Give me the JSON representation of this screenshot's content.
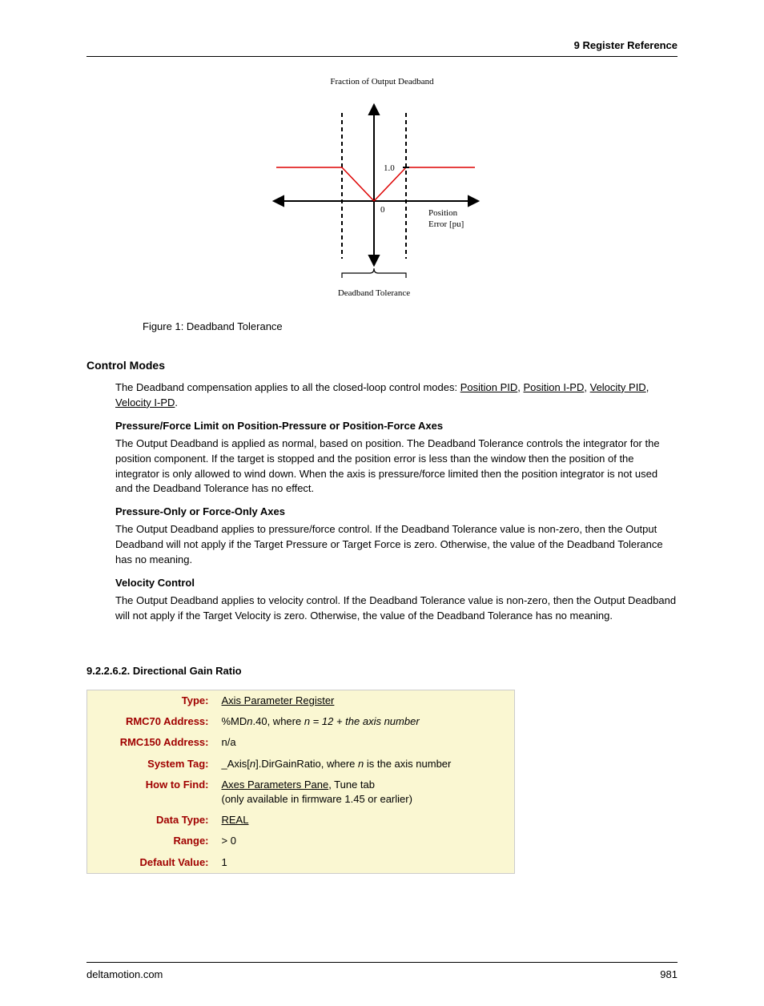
{
  "header": {
    "chapter": "9  Register Reference"
  },
  "figure": {
    "title_top": "Fraction of Output Deadband",
    "y_label": "1.0",
    "origin_label": "0",
    "x_axis_label_1": "Position",
    "x_axis_label_2": "Error [pu]",
    "bracket_label": "Deadband Tolerance",
    "caption": "Figure 1: Deadband Tolerance"
  },
  "control_modes": {
    "heading": "Control Modes",
    "intro_1": "The Deadband compensation applies to all the closed-loop control modes: ",
    "links": {
      "pos_pid": "Position PID",
      "pos_ipd": "Position I-PD",
      "vel_pid": "Velocity PID",
      "vel_ipd": "Velocity I-PD"
    },
    "sub1_h": "Pressure/Force Limit on Position-Pressure or Position-Force Axes",
    "sub1_p": "The Output Deadband is applied as normal, based on position. The Deadband Tolerance controls the integrator for the position component. If the target is stopped and the position error is less than the window then the position of the integrator is only allowed to wind down. When the axis is pressure/force limited then the position integrator is not used and the Deadband Tolerance has no effect.",
    "sub2_h": "Pressure-Only or Force-Only Axes",
    "sub2_p": "The Output Deadband applies to pressure/force control. If the Deadband Tolerance value is non-zero, then the Output Deadband will not apply if the Target Pressure or Target Force is zero. Otherwise, the value of the Deadband Tolerance has no meaning.",
    "sub3_h": "Velocity Control",
    "sub3_p": "The Output Deadband applies to velocity control. If the Deadband Tolerance value is non-zero, then the Output Deadband will not apply if the Target Velocity is zero. Otherwise, the value of the Deadband Tolerance has no meaning."
  },
  "register_section": {
    "heading": "9.2.2.6.2. Directional Gain Ratio",
    "rows": {
      "type_label": "Type:",
      "type_val_link": "Axis Parameter Register",
      "rmc70_label": "RMC70 Address:",
      "rmc70_pre": "%MD",
      "rmc70_ital": "n",
      "rmc70_mid": ".40, where ",
      "rmc70_eq": "n = 12 + the axis number",
      "rmc150_label": "RMC150 Address:",
      "rmc150_val": "n/a",
      "systag_label": "System Tag:",
      "systag_pre": "_Axis[",
      "systag_n1": "n",
      "systag_mid": "].DirGainRatio, where ",
      "systag_n2": "n",
      "systag_suf": " is the axis number",
      "howto_label": "How to Find:",
      "howto_link": "Axes Parameters Pane",
      "howto_suf": ", Tune tab",
      "howto_line2": "(only available in firmware 1.45 or earlier)",
      "dtype_label": "Data Type:",
      "dtype_val": "REAL",
      "range_label": "Range:",
      "range_val": "> 0",
      "default_label": "Default Value:",
      "default_val": "1"
    }
  },
  "footer": {
    "site": "deltamotion.com",
    "page": "981"
  },
  "chart_data": {
    "type": "line",
    "title": "Fraction of Output Deadband",
    "xlabel": "Position Error [pu]",
    "ylabel": "Fraction of Output Deadband",
    "ylim": [
      0,
      1.0
    ],
    "series": [
      {
        "name": "deadband-fraction",
        "description": "V-shape rising linearly from 0 at origin to 1.0 at ±(deadband tolerance half-width), flat at 1.0 outside",
        "x": [
          -2,
          -1,
          0,
          1,
          2
        ],
        "y": [
          1.0,
          1.0,
          0,
          1.0,
          1.0
        ]
      }
    ],
    "annotations": [
      {
        "text": "1.0",
        "x": 0,
        "y": 1.0
      },
      {
        "text": "0",
        "x": 0,
        "y": 0
      },
      {
        "text": "Deadband Tolerance",
        "role": "bracket",
        "span_x": [
          -1,
          1
        ]
      }
    ]
  }
}
